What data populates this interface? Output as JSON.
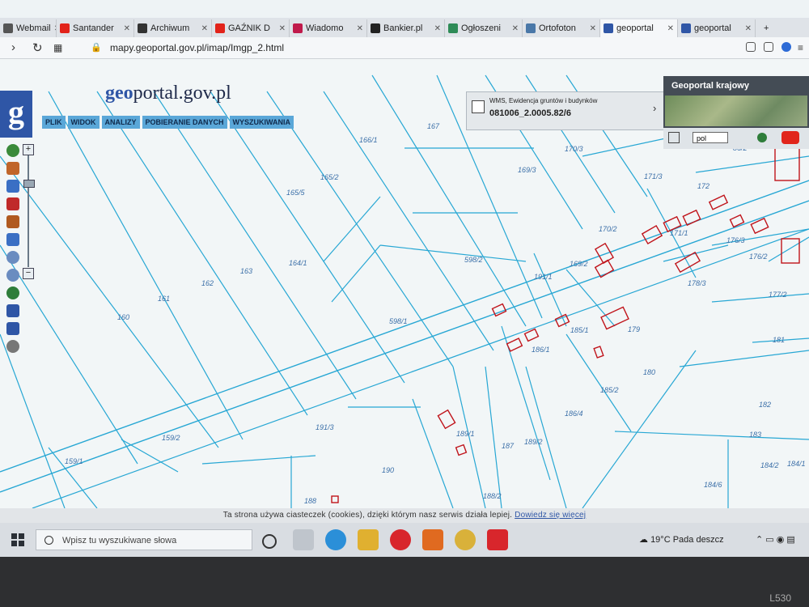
{
  "browser": {
    "tabs": [
      {
        "label": "Webmail",
        "favicon_color": "#555555"
      },
      {
        "label": "Santander",
        "favicon_color": "#e2231a"
      },
      {
        "label": "Archiwum",
        "favicon_color": "#333333"
      },
      {
        "label": "GAŹNIK D",
        "favicon_color": "#e2231a"
      },
      {
        "label": "Wiadomo",
        "favicon_color": "#c01a4b"
      },
      {
        "label": "Bankier.pl",
        "favicon_color": "#222222"
      },
      {
        "label": "Ogłoszeni",
        "favicon_color": "#2e8b57"
      },
      {
        "label": "Ortofoton",
        "favicon_color": "#4a78a8"
      },
      {
        "label": "geoportal",
        "favicon_color": "#2f56a6",
        "active": true
      },
      {
        "label": "geoportal",
        "favicon_color": "#2f56a6"
      }
    ],
    "new_tab": "+",
    "url": "mapy.geoportal.gov.pl/imap/Imgp_2.html"
  },
  "header": {
    "brand_prefix": "geo",
    "brand_suffix": "portal.gov.pl",
    "menu": [
      "PLIK",
      "WIDOK",
      "ANALIZY",
      "POBIERANIE DANYCH",
      "WYSZUKIWANIA"
    ]
  },
  "wms_panel": {
    "line1": "WMS, Ewidencja gruntów i budynków",
    "line2": "081006_2.0005.82/6",
    "arrow": "›"
  },
  "geoportal_krajowy": {
    "title": "Geoportal krajowy"
  },
  "right_tools": {
    "lang": "pol"
  },
  "zoom": {
    "plus": "+",
    "minus": "−"
  },
  "map": {
    "parcels": [
      "166/1",
      "167",
      "165/2",
      "165/5",
      "170/3",
      "169/3",
      "171/3",
      "172",
      "86/2",
      "164/1",
      "163",
      "162",
      "161",
      "160",
      "598/2",
      "598/1",
      "191/1",
      "169/2",
      "170/2",
      "171/1",
      "176/3",
      "176/2",
      "178/3",
      "177/2",
      "185/1",
      "179",
      "186/1",
      "180",
      "185/2",
      "186/4",
      "181",
      "182",
      "183",
      "184/2",
      "184/1",
      "189/1",
      "187",
      "189/2",
      "159/2",
      "159/1",
      "191/3",
      "190",
      "188/2",
      "188",
      "184/6"
    ],
    "parcel_color": "#3b6fa8",
    "line_color": "#27a7d4",
    "building_color": "#c0141b"
  },
  "cookie_bar": {
    "text": "Ta strona używa ciasteczek (cookies), dzięki którym nasz serwis działa lepiej.",
    "link": "Dowiedz się więcej"
  },
  "taskbar": {
    "search_placeholder": "Wpisz tu wyszukiwane słowa",
    "temperature": "19°C",
    "weather": "Pada deszcz"
  },
  "device": {
    "model": "L530"
  }
}
